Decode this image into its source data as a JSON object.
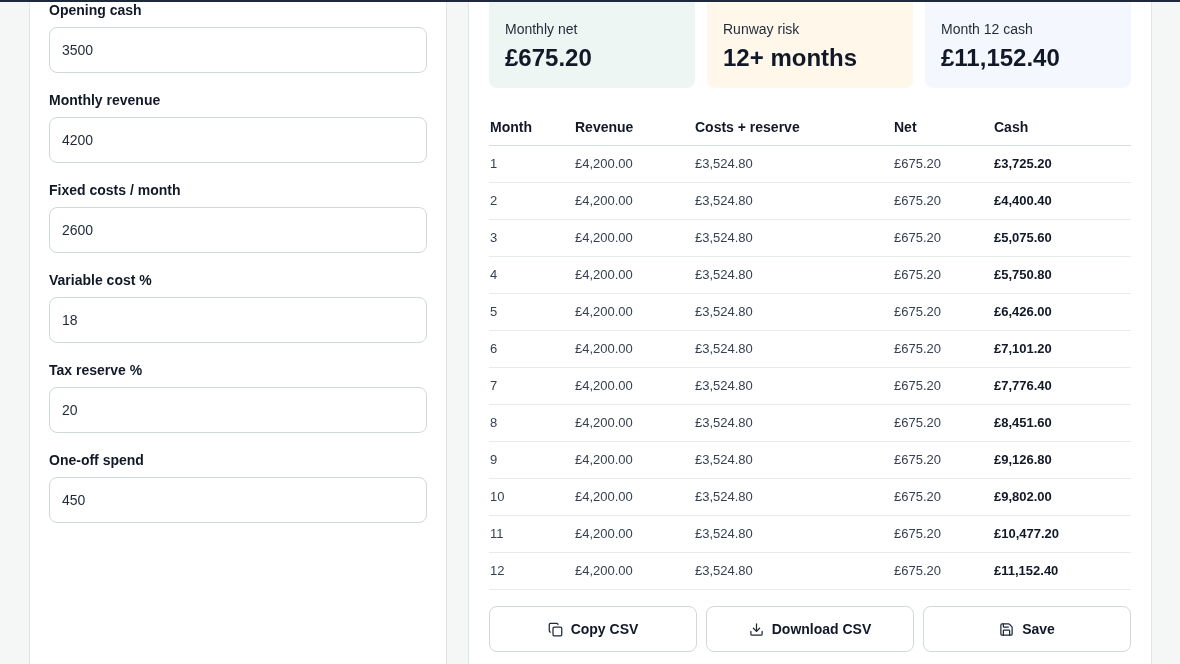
{
  "form": {
    "fields": [
      {
        "label": "Opening cash",
        "value": "3500"
      },
      {
        "label": "Monthly revenue",
        "value": "4200"
      },
      {
        "label": "Fixed costs / month",
        "value": "2600"
      },
      {
        "label": "Variable cost %",
        "value": "18"
      },
      {
        "label": "Tax reserve %",
        "value": "20"
      },
      {
        "label": "One-off spend",
        "value": "450"
      }
    ]
  },
  "summary": {
    "cards": [
      {
        "label": "Monthly net",
        "value": "£675.20",
        "color": "#edf6f3"
      },
      {
        "label": "Runway risk",
        "value": "12+ months",
        "color": "#fef7ea"
      },
      {
        "label": "Month 12 cash",
        "value": "£11,152.40",
        "color": "#f4f8fe"
      }
    ]
  },
  "table": {
    "columns": [
      "Month",
      "Revenue",
      "Costs + reserve",
      "Net",
      "Cash"
    ],
    "rows": [
      [
        "1",
        "£4,200.00",
        "£3,524.80",
        "£675.20",
        "£3,725.20"
      ],
      [
        "2",
        "£4,200.00",
        "£3,524.80",
        "£675.20",
        "£4,400.40"
      ],
      [
        "3",
        "£4,200.00",
        "£3,524.80",
        "£675.20",
        "£5,075.60"
      ],
      [
        "4",
        "£4,200.00",
        "£3,524.80",
        "£675.20",
        "£5,750.80"
      ],
      [
        "5",
        "£4,200.00",
        "£3,524.80",
        "£675.20",
        "£6,426.00"
      ],
      [
        "6",
        "£4,200.00",
        "£3,524.80",
        "£675.20",
        "£7,101.20"
      ],
      [
        "7",
        "£4,200.00",
        "£3,524.80",
        "£675.20",
        "£7,776.40"
      ],
      [
        "8",
        "£4,200.00",
        "£3,524.80",
        "£675.20",
        "£8,451.60"
      ],
      [
        "9",
        "£4,200.00",
        "£3,524.80",
        "£675.20",
        "£9,126.80"
      ],
      [
        "10",
        "£4,200.00",
        "£3,524.80",
        "£675.20",
        "£9,802.00"
      ],
      [
        "11",
        "£4,200.00",
        "£3,524.80",
        "£675.20",
        "£10,477.20"
      ],
      [
        "12",
        "£4,200.00",
        "£3,524.80",
        "£675.20",
        "£11,152.40"
      ]
    ]
  },
  "actions": [
    {
      "label": "Copy CSV",
      "kind": "copy"
    },
    {
      "label": "Download CSV",
      "kind": "download"
    },
    {
      "label": "Save",
      "kind": "save"
    }
  ]
}
